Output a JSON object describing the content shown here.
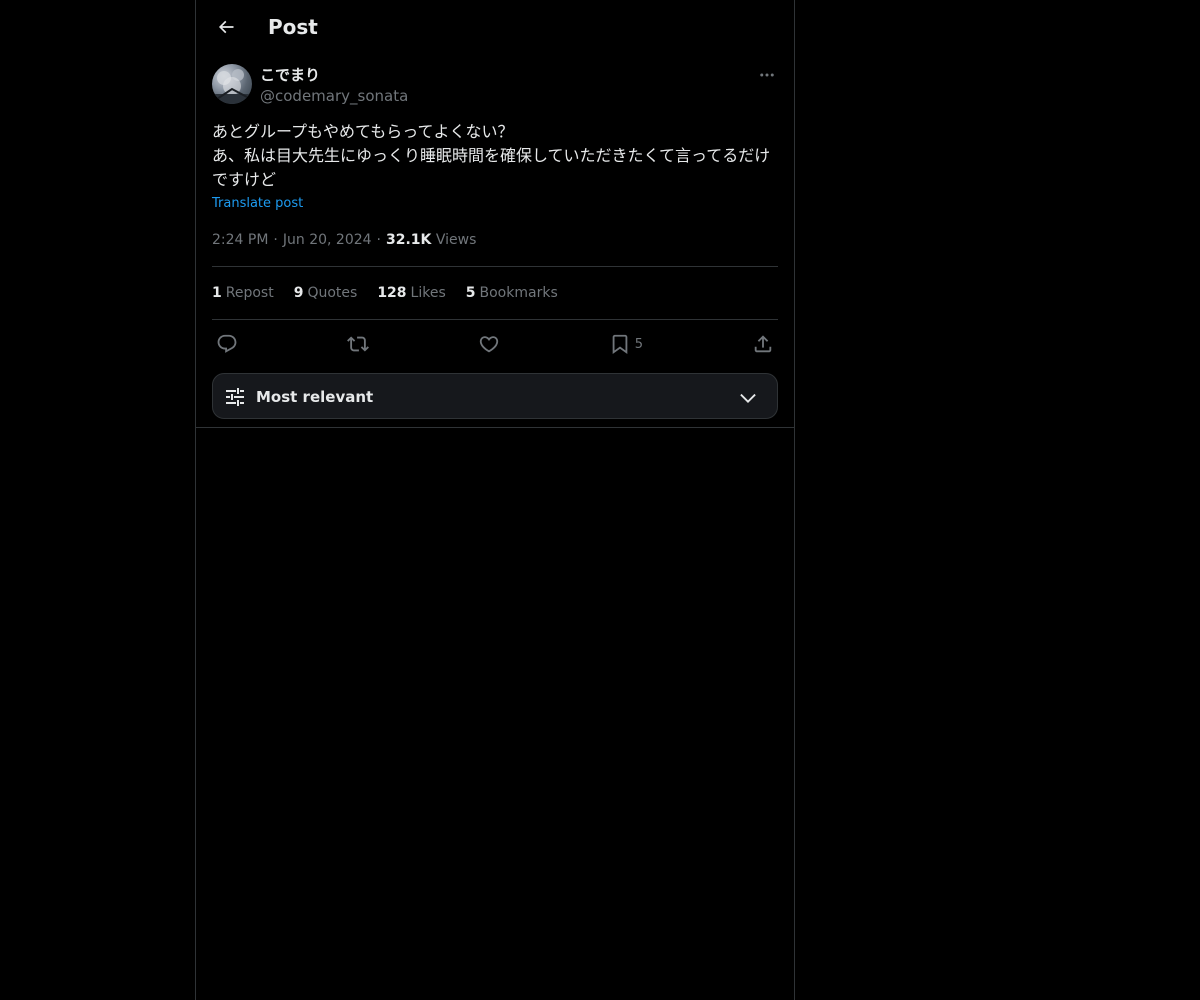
{
  "header": {
    "title": "Post",
    "back_icon": "arrow-left-icon"
  },
  "post": {
    "author": {
      "display_name": "こでまり",
      "handle": "@codemary_sonata"
    },
    "text": "あとグループもやめてもらってよくない？\nあ、私は目大先生にゆっくり睡眠時間を確保していただきたくて言ってるだけですけど",
    "translate_label": "Translate post",
    "time": "2:24 PM",
    "date": "Jun 20, 2024",
    "sep": "·",
    "views_count": "32.1K",
    "views_label": "Views"
  },
  "stats": [
    {
      "num": "1",
      "label": "Repost"
    },
    {
      "num": "9",
      "label": "Quotes"
    },
    {
      "num": "128",
      "label": "Likes"
    },
    {
      "num": "5",
      "label": "Bookmarks"
    }
  ],
  "actions": {
    "reply_icon": "reply-icon",
    "repost_icon": "repost-icon",
    "like_icon": "heart-icon",
    "bookmark_icon": "bookmark-icon",
    "bookmark_count": "5",
    "share_icon": "share-icon"
  },
  "sort": {
    "label": "Most relevant",
    "icon": "sliders-icon",
    "chevron": "chevron-down-icon"
  },
  "colors": {
    "background": "#000000",
    "text_primary": "#e7e9ea",
    "text_secondary": "#71767b",
    "accent": "#1d9bf0",
    "border": "#2f3336"
  }
}
